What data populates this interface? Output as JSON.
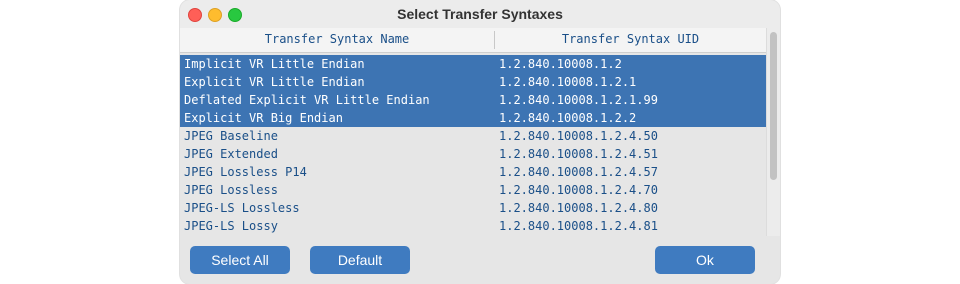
{
  "window": {
    "title": "Select Transfer Syntaxes"
  },
  "table": {
    "columns": [
      "Transfer Syntax Name",
      "Transfer Syntax UID"
    ],
    "rows": [
      {
        "name": "Implicit VR Little Endian",
        "uid": "1.2.840.10008.1.2",
        "selected": true
      },
      {
        "name": "Explicit VR Little Endian",
        "uid": "1.2.840.10008.1.2.1",
        "selected": true
      },
      {
        "name": "Deflated Explicit VR Little Endian",
        "uid": "1.2.840.10008.1.2.1.99",
        "selected": true
      },
      {
        "name": "Explicit VR Big Endian",
        "uid": "1.2.840.10008.1.2.2",
        "selected": true
      },
      {
        "name": "JPEG Baseline",
        "uid": "1.2.840.10008.1.2.4.50",
        "selected": false
      },
      {
        "name": "JPEG Extended",
        "uid": "1.2.840.10008.1.2.4.51",
        "selected": false
      },
      {
        "name": "JPEG Lossless P14",
        "uid": "1.2.840.10008.1.2.4.57",
        "selected": false
      },
      {
        "name": "JPEG Lossless",
        "uid": "1.2.840.10008.1.2.4.70",
        "selected": false
      },
      {
        "name": "JPEG-LS Lossless",
        "uid": "1.2.840.10008.1.2.4.80",
        "selected": false
      },
      {
        "name": "JPEG-LS Lossy",
        "uid": "1.2.840.10008.1.2.4.81",
        "selected": false
      }
    ]
  },
  "buttons": {
    "select_all": "Select All",
    "default": "Default",
    "ok": "Ok"
  },
  "colors": {
    "selection": "#3d74b3",
    "button": "#3f7bc0",
    "text": "#1a4f88"
  }
}
